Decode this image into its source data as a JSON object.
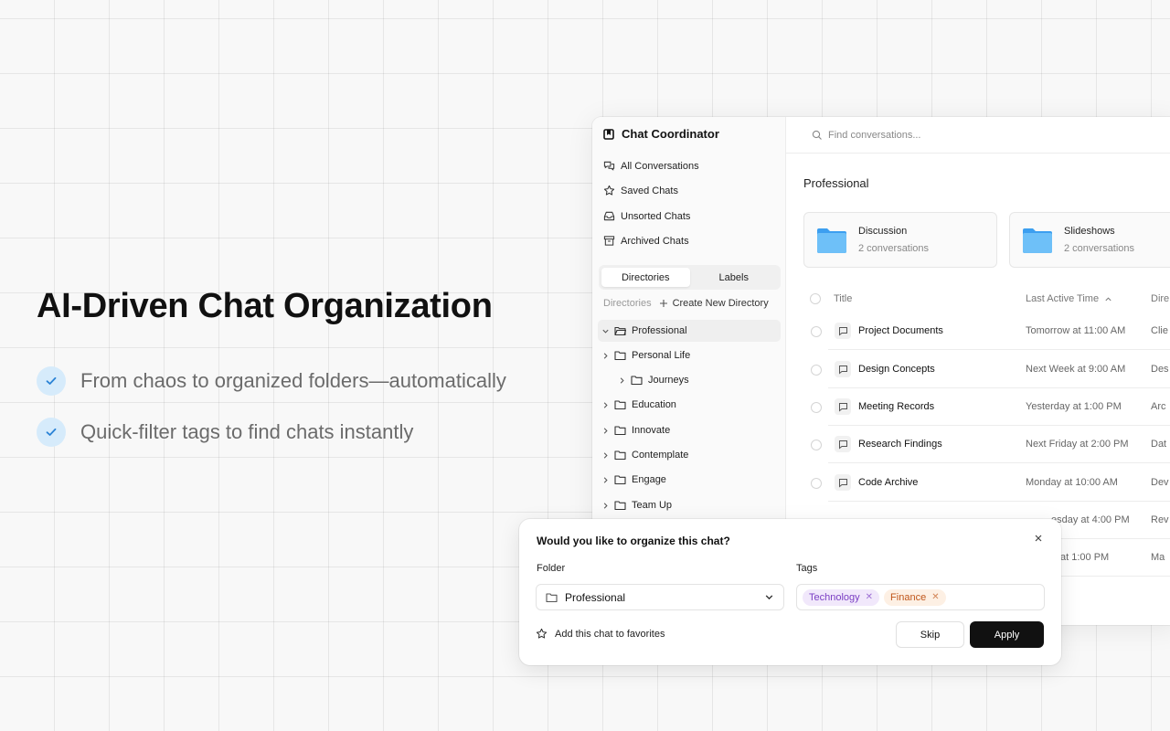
{
  "hero": {
    "title": "AI-Driven Chat Organization",
    "features": [
      "From chaos to organized folders—automatically",
      "Quick-filter tags to find chats instantly"
    ]
  },
  "app": {
    "brand": "Chat Coordinator",
    "nav": [
      {
        "label": "All Conversations",
        "icon": "conversations-icon"
      },
      {
        "label": "Saved Chats",
        "icon": "star-icon"
      },
      {
        "label": "Unsorted Chats",
        "icon": "inbox-icon"
      },
      {
        "label": "Archived Chats",
        "icon": "archive-icon"
      }
    ],
    "segments": [
      "Directories",
      "Labels"
    ],
    "directories_label": "Directories",
    "create_directory": "Create New Directory",
    "tree": [
      {
        "label": "Professional",
        "expanded": true,
        "depth": 0
      },
      {
        "label": "Personal Life",
        "expanded": false,
        "depth": 0
      },
      {
        "label": "Journeys",
        "expanded": false,
        "depth": 1
      },
      {
        "label": "Education",
        "expanded": false,
        "depth": 0
      },
      {
        "label": "Innovate",
        "expanded": false,
        "depth": 0
      },
      {
        "label": "Contemplate",
        "expanded": false,
        "depth": 0
      },
      {
        "label": "Engage",
        "expanded": false,
        "depth": 0
      },
      {
        "label": "Team Up",
        "expanded": false,
        "depth": 0
      }
    ],
    "search_placeholder": "Find conversations...",
    "section_title": "Professional",
    "folders": [
      {
        "name": "Discussion",
        "count": "2 conversations"
      },
      {
        "name": "Slideshows",
        "count": "2 conversations"
      }
    ],
    "table": {
      "headers": {
        "title": "Title",
        "last_active": "Last Active Time",
        "dir": "Dire"
      },
      "rows": [
        {
          "title": "Project Documents",
          "time": "Tomorrow at 11:00 AM",
          "dir": "Clie"
        },
        {
          "title": "Design Concepts",
          "time": "Next Week at 9:00 AM",
          "dir": "Des"
        },
        {
          "title": "Meeting Records",
          "time": "Yesterday at 1:00 PM",
          "dir": "Arc"
        },
        {
          "title": "Research Findings",
          "time": "Next Friday at 2:00 PM",
          "dir": "Dat"
        },
        {
          "title": "Code Archive",
          "time": "Monday at 10:00 AM",
          "dir": "Dev"
        },
        {
          "title": "",
          "time": "esday at 4:00 PM",
          "dir": "Rev"
        },
        {
          "title": "",
          "time": "at 1:00 PM",
          "dir": "Ma"
        }
      ]
    }
  },
  "dialog": {
    "title": "Would you like to organize this chat?",
    "folder_label": "Folder",
    "tags_label": "Tags",
    "folder_value": "Professional",
    "tags": [
      {
        "label": "Technology",
        "color": "#7b3fc4"
      },
      {
        "label": "Finance",
        "color": "#c0561a"
      }
    ],
    "favorite_label": "Add this chat to favorites",
    "skip_label": "Skip",
    "apply_label": "Apply"
  },
  "colors": {
    "accent": "#111111",
    "check_bg": "#d6ebfb",
    "check_fg": "#2b83d6",
    "folder_blue": "#5bb6f5"
  }
}
